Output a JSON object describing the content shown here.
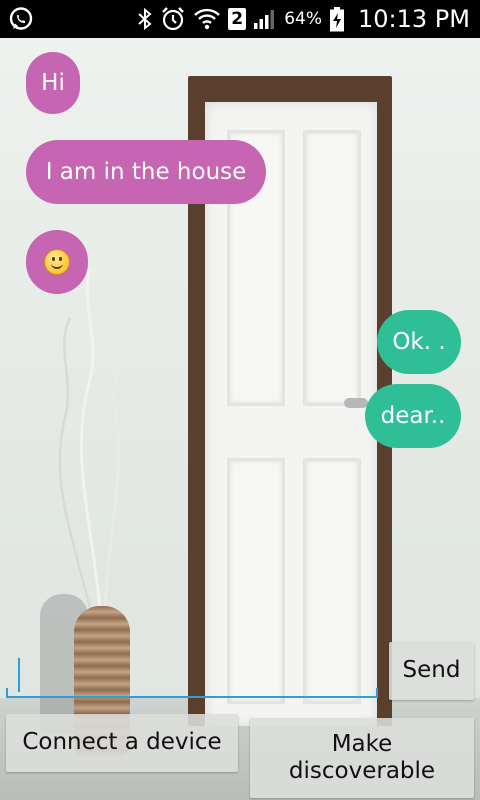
{
  "status_bar": {
    "sim_badge": "2",
    "battery": "64%",
    "time": "10:13 PM",
    "icons": [
      "whatsapp-icon",
      "bluetooth-icon",
      "alarm-icon",
      "wifi-icon",
      "signal-icon",
      "battery-charging-icon"
    ]
  },
  "messages": [
    {
      "side": "received",
      "text": "Hi"
    },
    {
      "side": "received",
      "text": "I am in the house"
    },
    {
      "side": "received",
      "text": "",
      "emoji": "smiley-emoji"
    },
    {
      "side": "sent",
      "text": "Ok. ."
    },
    {
      "side": "sent",
      "text": "dear.."
    }
  ],
  "composer": {
    "value": "",
    "send_label": "Send"
  },
  "actions": {
    "connect_label": "Connect a device",
    "discoverable_label": "Make discoverable"
  },
  "colors": {
    "received_bubble": "#c665b2",
    "sent_bubble": "#2fbf97",
    "accent": "#2d9ed6",
    "door_frame": "#5a3f2c"
  }
}
